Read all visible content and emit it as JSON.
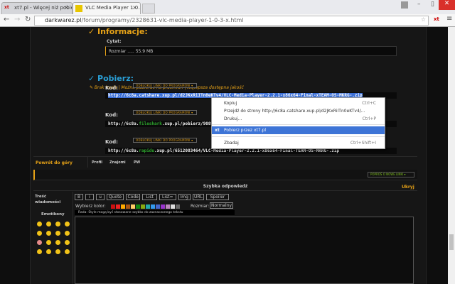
{
  "browser": {
    "tabs": [
      {
        "title": "xt7.pl - Więcej niż pobieraj",
        "icon": "xt7-icon"
      },
      {
        "title": "VLC Media Player 1.0.3",
        "icon": "vlc-icon"
      }
    ],
    "url_domain": "darkwarez.pl",
    "url_path": "/forum/programy/2328631-vlc-media-player-1-0-3-x.html"
  },
  "post": {
    "info_heading": "✓ Informacje:",
    "quote_label": "Cytat:",
    "quote_text": "Rozmiar ..... 55.9 MB",
    "download_heading": "✓ Pobierz:",
    "download_notes": "✎ Brak hasła | Można pobierać na przemian | Najlepsza dostępna jakość",
    "codes": [
      {
        "label": "Kod:",
        "unlock": "ODBLOKUJ LINKI DO PROGRAMÓW ▾",
        "pre": "http://6c8a.",
        "host": "catshare",
        "post": ".xup.pl/d2JKxRiITn0eKTv4/VLC-Media-Player-2.2.1-x86x64-Final-xTEAM-OS-MKRG-.zip",
        "host_color": "#ffffff"
      },
      {
        "label": "Kod:",
        "unlock": "ODBLOKUJ LINKI DO PROGRAMÓW ▾",
        "pre": "http://6c8a.",
        "host": "fileshark",
        "post": ".xup.pl/pobierz/90898",
        "host_color": "#2ea82e"
      },
      {
        "label": "Kod:",
        "unlock": "ODBLOKUJ LINKI DO PROGRAMÓW ▾",
        "pre": "http://6c8a.",
        "host": "rapidu",
        "post": ".xup.pl/6512083464/VLC-Media-Player-2.2.1-x86x64-Final-TEAM-OS-MKRG-.zip",
        "host_color": "#2ea82e"
      }
    ]
  },
  "context_menu": {
    "items": [
      {
        "label": "Kopiuj",
        "shortcut": "Ctrl+C"
      },
      {
        "label": "Przejdź do strony http://6c8a.catshare.xup.pl/d2JKxRiITn0eKTv4/...",
        "shortcut": ""
      },
      {
        "label": "Drukuj...",
        "shortcut": "Ctrl+P"
      },
      {
        "label": "Pobierz przez xt7.pl",
        "shortcut": ""
      },
      {
        "label": "Zbadaj",
        "shortcut": "Ctrl+Shift+I"
      }
    ]
  },
  "post_footer": {
    "back_to_top": "Powrót do góry",
    "links": [
      "Profil",
      "Znajomi",
      "PW"
    ],
    "request_links": "POPROŚ O NOWE LINKI ▾"
  },
  "quick_reply": {
    "title": "Szybka odpowiedź",
    "hide": "Ukryj",
    "message_label": "Treść wiadomości",
    "emoticons_label": "Emotikony",
    "buttons": [
      "B",
      "i",
      "u",
      "Quote",
      "Code",
      "List",
      "List=",
      "Img",
      "URL",
      "Spoiler"
    ],
    "color_label": "Wybierz kolor:",
    "colors": [
      "#cc1111",
      "#ee2222",
      "#ffaa00",
      "#aa5511",
      "#ffcc66",
      "#118811",
      "#88aa11",
      "#22aaaa",
      "#3399ee",
      "#4466cc",
      "#9933cc",
      "#bb88bb",
      "#dddddd",
      "#666666"
    ],
    "size_label": "Rozmiar:",
    "size_value": "Normalny",
    "hint": "Rada: Style mogą być stosowane szybko do zaznaczonego tekstu"
  },
  "colors": {
    "accent_orange": "#e8a317",
    "heading_blue": "#2a9fd6",
    "selection": "#3d74d6"
  }
}
